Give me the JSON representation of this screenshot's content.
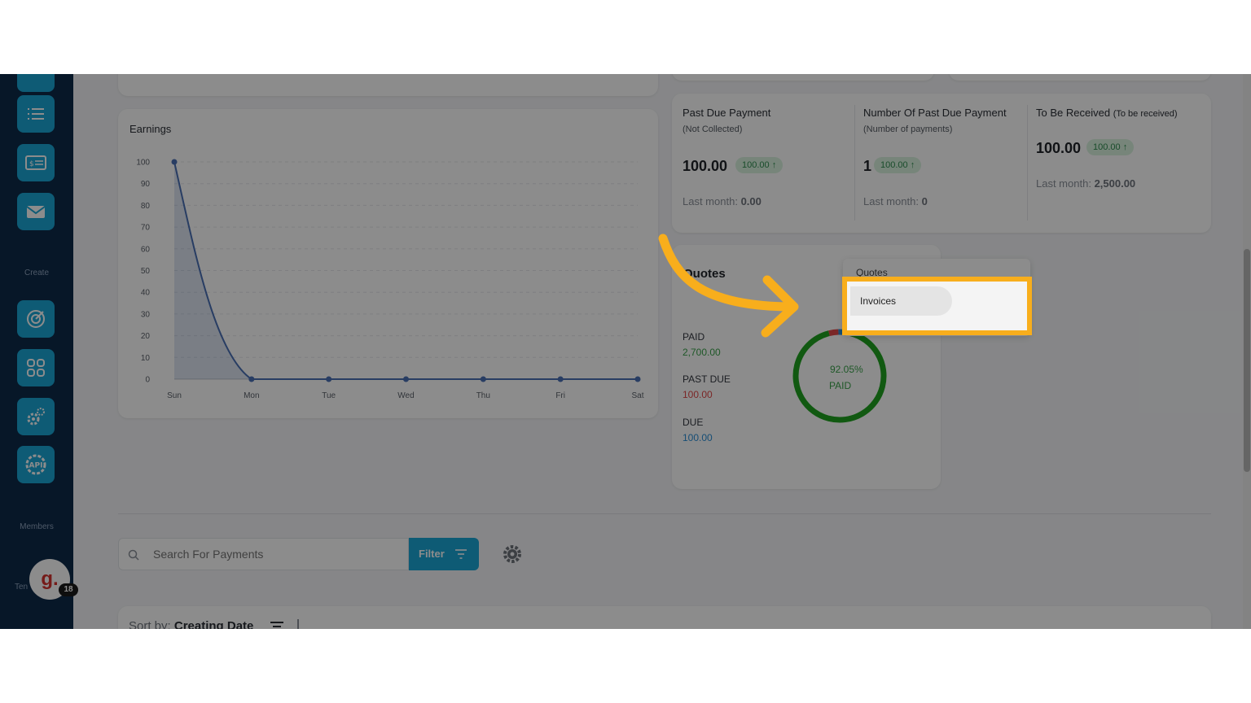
{
  "sidebar": {
    "section_create": "Create",
    "section_members": "Members",
    "section_team_partial": "Ten",
    "avatar_letter": "g.",
    "avatar_badge": "18",
    "icons": [
      "grid-icon",
      "list-icon",
      "invoice-icon",
      "mail-icon",
      "target-icon",
      "apps-icon",
      "settings-icon",
      "api-icon"
    ],
    "api_label": "API"
  },
  "earnings": {
    "title": "Earnings"
  },
  "chart_data": {
    "type": "line",
    "title": "Earnings",
    "categories": [
      "Sun",
      "Mon",
      "Tue",
      "Wed",
      "Thu",
      "Fri",
      "Sat"
    ],
    "values": [
      100,
      0,
      0,
      0,
      0,
      0,
      0
    ],
    "ylim": [
      0,
      100
    ],
    "yticks": [
      0,
      10,
      20,
      30,
      40,
      50,
      60,
      70,
      80,
      90,
      100
    ],
    "grid": true,
    "area_fill": true,
    "color": "#4a6fb5"
  },
  "kpis": [
    {
      "title": "Past Due Payment",
      "subtitle": "(Not Collected)",
      "value": "100.00",
      "badge": "100.00 ↑",
      "last_label": "Last month:",
      "last_value": "0.00"
    },
    {
      "title": "Number Of Past Due Payment",
      "subtitle": "(Number of payments)",
      "value": "1",
      "badge": "100.00 ↑",
      "last_label": "Last month:",
      "last_value": "0"
    },
    {
      "title": "To Be Received",
      "title_note": "(To be received)",
      "value": "100.00",
      "badge": "100.00 ↑",
      "last_label": "Last month:",
      "last_value": "2,500.00"
    }
  ],
  "summary": {
    "title": "Quotes",
    "stats": [
      {
        "label": "PAID",
        "value": "2,700.00",
        "color": "#3aa14a"
      },
      {
        "label": "PAST DUE",
        "value": "100.00",
        "color": "#e04848"
      },
      {
        "label": "DUE",
        "value": "100.00",
        "color": "#2b8fd6"
      }
    ],
    "donut": {
      "percent_label": "92.05%",
      "caption": "PAID",
      "paid_fraction": 0.9205,
      "past_due_fraction": 0.0341,
      "due_fraction": 0.0341,
      "colors": {
        "paid": "#1fa31f",
        "past_due": "#e04848",
        "due": "#2b8fd6"
      }
    }
  },
  "dropdown": {
    "options": [
      "Quotes",
      "Invoices"
    ],
    "highlighted": "Invoices",
    "highlight_color": "#f8ae1c"
  },
  "toolbar": {
    "search_placeholder": "Search For Payments",
    "filter_label": "Filter",
    "sort_label": "Sort by:",
    "sort_value": "Creating Date"
  },
  "colors": {
    "accent": "#1aa6d6",
    "arrow": "#f8ae1c"
  }
}
